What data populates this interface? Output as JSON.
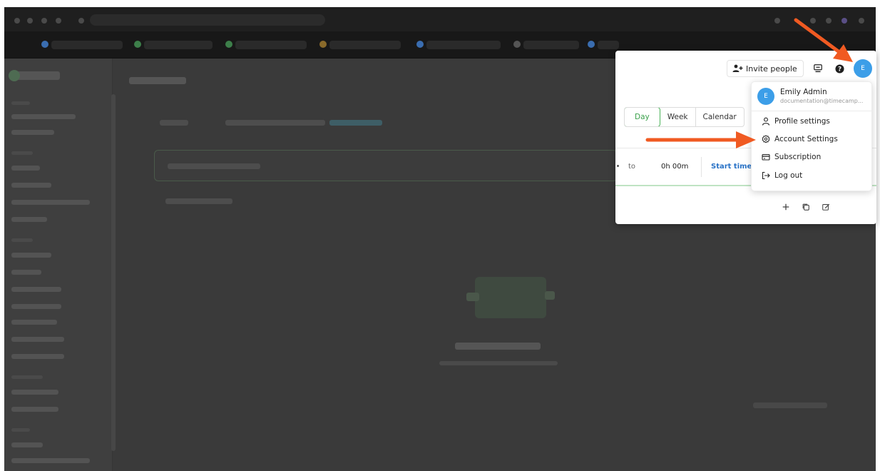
{
  "header": {
    "invite_label": "Invite people",
    "avatar_initial": "E"
  },
  "user_menu": {
    "avatar_initial": "E",
    "name": "Emily Admin",
    "email": "documentation@timecamp...",
    "items": [
      {
        "label": "Profile settings",
        "icon": "user-icon"
      },
      {
        "label": "Account Settings",
        "icon": "gear-icon"
      },
      {
        "label": "Subscription",
        "icon": "card-icon"
      },
      {
        "label": "Log out",
        "icon": "logout-icon"
      }
    ]
  },
  "view_tabs": [
    "Day",
    "Week",
    "Calendar"
  ],
  "timer_row": {
    "to_label": "to",
    "duration": "0h 00m",
    "start_label": "Start timer"
  },
  "colors": {
    "accent_green": "#4cb35a",
    "avatar_blue": "#3c9ee8",
    "link_blue": "#2a73c7",
    "annotation_arrow": "#f05a22"
  }
}
